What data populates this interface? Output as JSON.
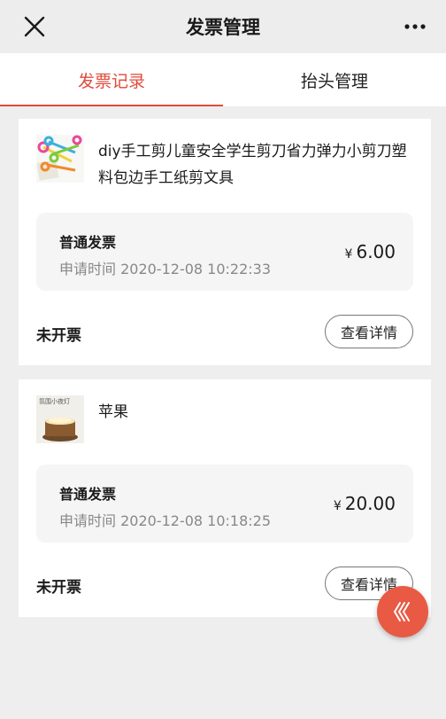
{
  "nav": {
    "title": "发票管理",
    "close_icon": "close-icon",
    "more_icon": "more-dots-icon"
  },
  "tabs": [
    {
      "label": "发票记录",
      "active": true
    },
    {
      "label": "抬头管理",
      "active": false
    }
  ],
  "records": [
    {
      "product_name": "diy手工剪儿童安全学生剪刀省力弹力小剪刀塑料包边手工纸剪文具",
      "thumb": "scissors-thumbnail",
      "invoice_type": "普通发票",
      "apply_time": "申请时间 2020-12-08 10:22:33",
      "currency": "¥",
      "amount": "6.00",
      "status": "未开票",
      "detail_button": "查看详情"
    },
    {
      "product_name": "苹果",
      "thumb": "night-lamp-thumbnail",
      "thumb_caption": "氛围小夜灯",
      "invoice_type": "普通发票",
      "apply_time": "申请时间 2020-12-08 10:18:25",
      "currency": "¥",
      "amount": "20.00",
      "status": "未开票",
      "detail_button": "查看详情"
    }
  ],
  "fab_icon": "expand-chevrons-icon",
  "colors": {
    "accent": "#e04b3a",
    "fab": "#e85a44",
    "background": "#eeeeee"
  }
}
